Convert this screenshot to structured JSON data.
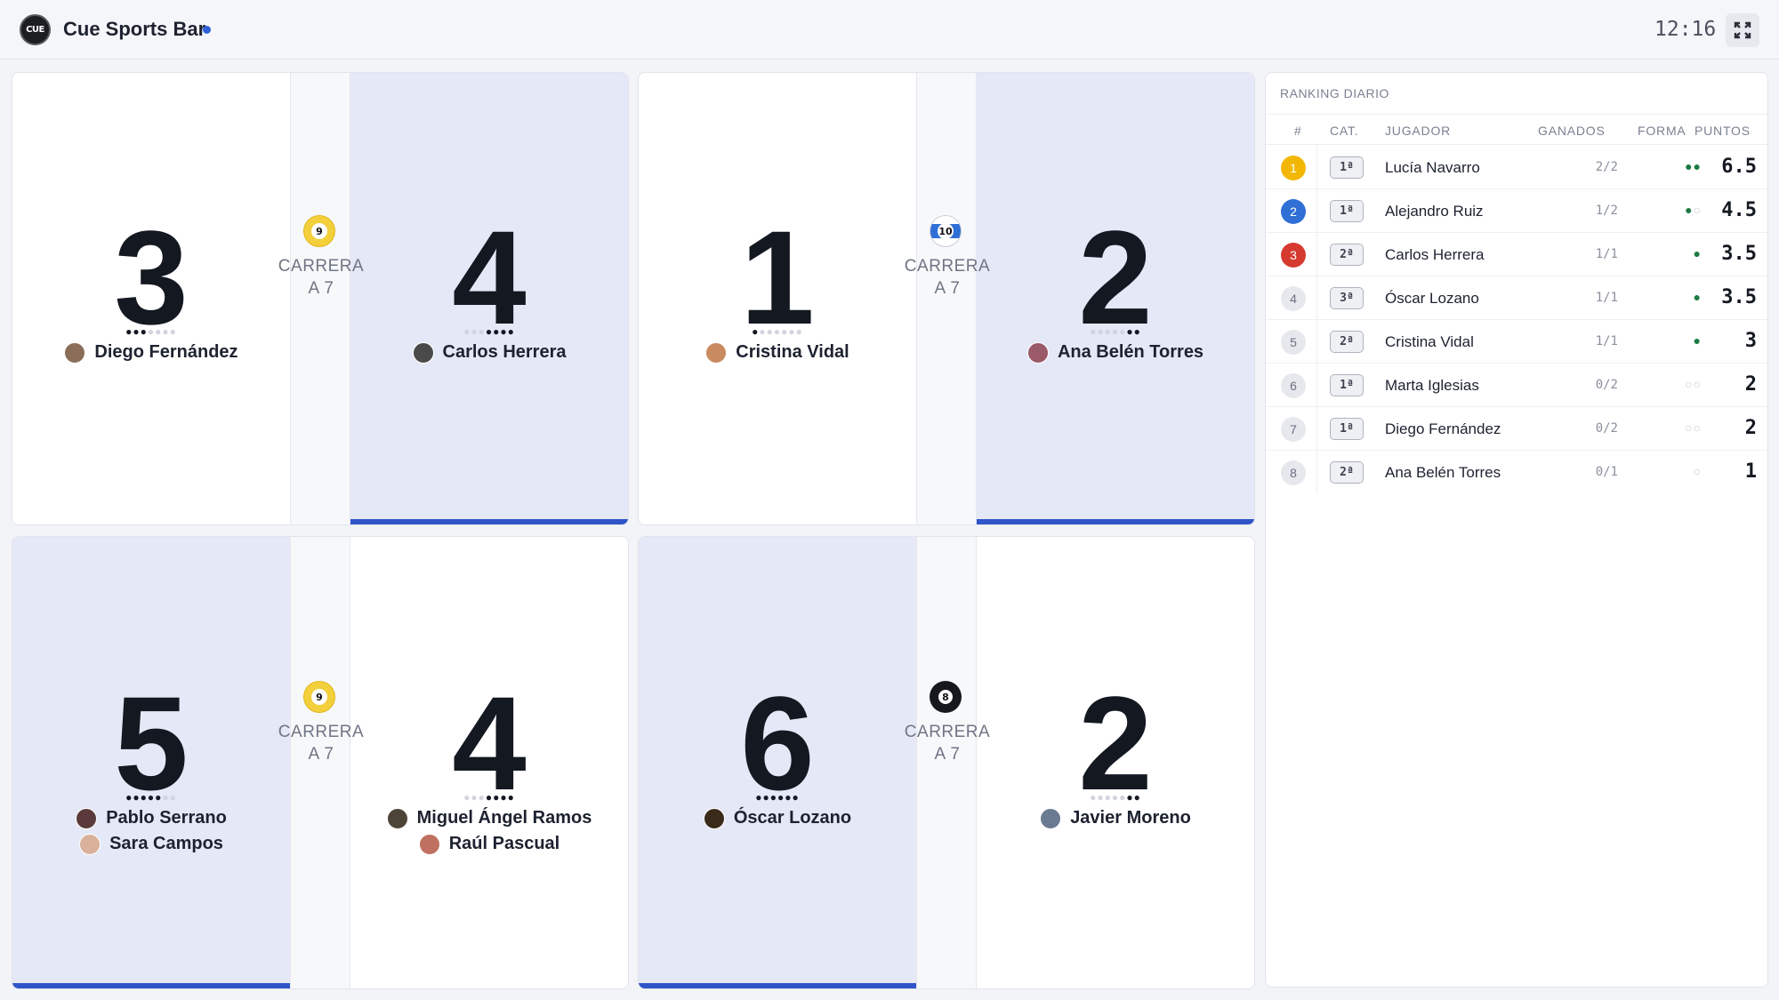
{
  "header": {
    "logo_text": "CUE",
    "venue": "Cue Sports Bar",
    "live_color": "#2f5fd6",
    "time": "12:16",
    "fullscreen_icon": "expand-icon"
  },
  "colors": {
    "accent": "#2f55c8",
    "winning_bg": "#e5e8f6",
    "rank_gold": "#f2b705",
    "rank_blue": "#2f6fd6",
    "rank_red": "#d63a2f",
    "form_win": "#1c7a44"
  },
  "tables": [
    {
      "ball": "9",
      "race_label": "CARRERA",
      "race_to": "A 7",
      "leading": "right",
      "left": {
        "score": "3",
        "rack_won": 3,
        "rack_total": 7,
        "players": [
          {
            "name": "Diego Fernández",
            "avatar_color": "#8a6e5a"
          }
        ]
      },
      "right": {
        "score": "4",
        "rack_won": 4,
        "rack_total": 7,
        "players": [
          {
            "name": "Carlos Herrera",
            "avatar_color": "#4a4a4a"
          }
        ]
      }
    },
    {
      "ball": "10",
      "race_label": "CARRERA",
      "race_to": "A 7",
      "leading": "right",
      "left": {
        "score": "1",
        "rack_won": 1,
        "rack_total": 7,
        "players": [
          {
            "name": "Cristina Vidal",
            "avatar_color": "#c98a60"
          }
        ]
      },
      "right": {
        "score": "2",
        "rack_won": 2,
        "rack_total": 7,
        "players": [
          {
            "name": "Ana Belén Torres",
            "avatar_color": "#9a5a6a"
          }
        ]
      }
    },
    {
      "ball": "9",
      "race_label": "CARRERA",
      "race_to": "A 7",
      "leading": "left",
      "left": {
        "score": "5",
        "rack_won": 5,
        "rack_total": 7,
        "players": [
          {
            "name": "Pablo Serrano",
            "avatar_color": "#5a3a3a"
          },
          {
            "name": "Sara Campos",
            "avatar_color": "#d9b09a"
          }
        ]
      },
      "right": {
        "score": "4",
        "rack_won": 4,
        "rack_total": 7,
        "players": [
          {
            "name": "Miguel Ángel Ramos",
            "avatar_color": "#4d4438"
          },
          {
            "name": "Raúl Pascual",
            "avatar_color": "#c07060"
          }
        ]
      }
    },
    {
      "ball": "8",
      "race_label": "CARRERA",
      "race_to": "A 7",
      "leading": "left",
      "left": {
        "score": "6",
        "rack_won": 6,
        "rack_total": 6,
        "players": [
          {
            "name": "Óscar Lozano",
            "avatar_color": "#3a2a1a"
          }
        ]
      },
      "right": {
        "score": "2",
        "rack_won": 2,
        "rack_total": 7,
        "players": [
          {
            "name": "Javier Moreno",
            "avatar_color": "#6a7a90"
          }
        ]
      }
    }
  ],
  "ranking": {
    "title": "RANKING DIARIO",
    "columns": {
      "pos": "#",
      "cat": "CAT.",
      "player": "JUGADOR",
      "won": "GANADOS",
      "form": "FORMA",
      "points": "PUNTOS"
    },
    "rows": [
      {
        "pos": "1",
        "cat": "1ª",
        "name": "Lucía Navarro",
        "won": "2/2",
        "form": [
          1,
          1
        ],
        "points": "6.5",
        "badge": "#f2b705"
      },
      {
        "pos": "2",
        "cat": "1ª",
        "name": "Alejandro Ruiz",
        "won": "1/2",
        "form": [
          1,
          0
        ],
        "points": "4.5",
        "badge": "#2f6fd6"
      },
      {
        "pos": "3",
        "cat": "2ª",
        "name": "Carlos Herrera",
        "won": "1/1",
        "form": [
          1
        ],
        "points": "3.5",
        "badge": "#d63a2f"
      },
      {
        "pos": "4",
        "cat": "3ª",
        "name": "Óscar Lozano",
        "won": "1/1",
        "form": [
          1
        ],
        "points": "3.5",
        "badge": ""
      },
      {
        "pos": "5",
        "cat": "2ª",
        "name": "Cristina Vidal",
        "won": "1/1",
        "form": [
          1
        ],
        "points": "3",
        "badge": ""
      },
      {
        "pos": "6",
        "cat": "1ª",
        "name": "Marta Iglesias",
        "won": "0/2",
        "form": [
          0,
          0
        ],
        "points": "2",
        "badge": ""
      },
      {
        "pos": "7",
        "cat": "1ª",
        "name": "Diego Fernández",
        "won": "0/2",
        "form": [
          0,
          0
        ],
        "points": "2",
        "badge": ""
      },
      {
        "pos": "8",
        "cat": "2ª",
        "name": "Ana Belén Torres",
        "won": "0/1",
        "form": [
          0
        ],
        "points": "1",
        "badge": ""
      }
    ]
  }
}
